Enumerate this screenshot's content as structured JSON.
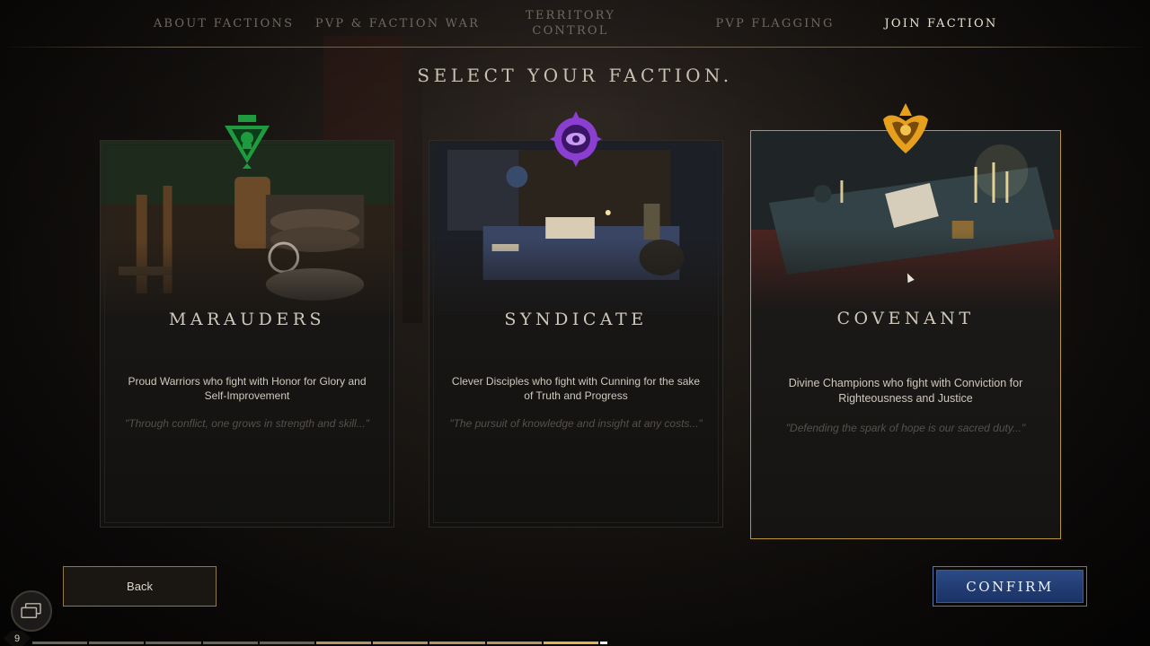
{
  "nav": {
    "tabs": [
      {
        "label": "ABOUT FACTIONS"
      },
      {
        "label": "PVP & FACTION WAR"
      },
      {
        "label": "TERRITORY CONTROL"
      },
      {
        "label": "PVP FLAGGING"
      },
      {
        "label": "JOIN FACTION"
      }
    ],
    "active_tab": "JOIN FACTION"
  },
  "page_title": "SELECT YOUR FACTION.",
  "factions": [
    {
      "name": "MARAUDERS",
      "description": "Proud Warriors who fight with Honor for Glory and Self-Improvement",
      "quote": "\"Through conflict, one grows in strength and skill...\"",
      "color": "#1f9a3e",
      "icon": "marauders-emblem-icon"
    },
    {
      "name": "SYNDICATE",
      "description": "Clever Disciples who fight with Cunning for the sake of Truth and Progress",
      "quote": "\"The pursuit of knowledge and insight at any costs...\"",
      "color": "#8a3fd1",
      "icon": "syndicate-emblem-icon"
    },
    {
      "name": "COVENANT",
      "description": "Divine Champions who fight with Conviction for Righteousness and Justice",
      "quote": "\"Defending the spark of hope is our sacred duty...\"",
      "color": "#e6a01e",
      "icon": "covenant-emblem-icon",
      "selected": true
    }
  ],
  "buttons": {
    "back": "Back",
    "confirm": "CONFIRM"
  },
  "hud": {
    "level": "9",
    "chat_icon": "chat-icon"
  },
  "colors": {
    "selected_border": "#b8973c",
    "confirm_blue": "#2c4a85"
  }
}
